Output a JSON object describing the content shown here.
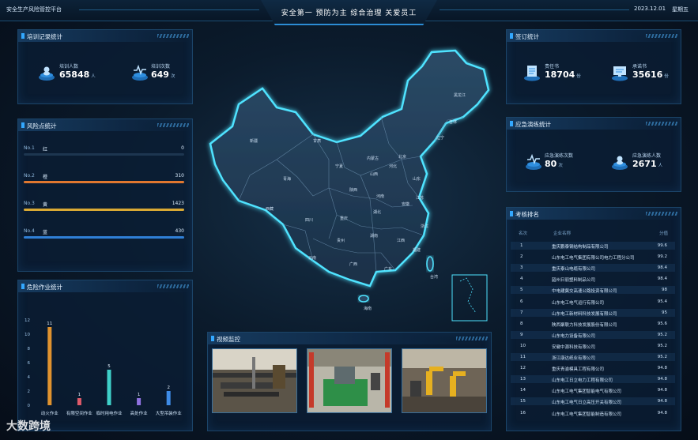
{
  "header": {
    "left_title": "安全生产风险管控平台",
    "center_title": "安全第一 预防为主 综合治理 关爱员工",
    "date": "2023.12.01",
    "weekday": "星期五"
  },
  "training": {
    "title": "培训记录统计",
    "stats": [
      {
        "label": "培训人数",
        "value": "65848",
        "unit": "人",
        "icon": "people-stack-icon"
      },
      {
        "label": "培训次数",
        "value": "649",
        "unit": "次",
        "icon": "pulse-stack-icon"
      }
    ]
  },
  "risk": {
    "title": "风险点统计",
    "levels": [
      {
        "no": "No.1",
        "name": "红",
        "value": "0",
        "fraction": 0.0,
        "color": "#e0433b"
      },
      {
        "no": "No.2",
        "name": "橙",
        "value": "310",
        "fraction": 1.0,
        "color": "#e0772f"
      },
      {
        "no": "No.3",
        "name": "黄",
        "value": "1423",
        "fraction": 1.0,
        "color": "#d9a934"
      },
      {
        "no": "No.4",
        "name": "蓝",
        "value": "430",
        "fraction": 1.0,
        "color": "#2f7fd6"
      }
    ]
  },
  "hazard": {
    "title": "危险作业统计",
    "chart_data": {
      "type": "bar",
      "categories": [
        "动火作业",
        "有限空间作业",
        "临时用电作业",
        "高处作业",
        "大型吊装作业"
      ],
      "values": [
        11,
        1,
        5,
        1,
        2
      ],
      "ylim": [
        0,
        12
      ],
      "yticks": [
        "0",
        "2",
        "4",
        "6",
        "8",
        "10",
        "12"
      ],
      "colors": [
        "#e0932f",
        "#e05a6a",
        "#3fd0c9",
        "#8f72e0",
        "#3e8be6"
      ],
      "grid": false,
      "legend": "none"
    }
  },
  "map": {
    "provinces": [
      "新疆",
      "西藏",
      "青海",
      "甘肃",
      "四川",
      "内蒙古",
      "黑龙江",
      "吉林",
      "辽宁",
      "河北",
      "北京",
      "山西",
      "陕西",
      "宁夏",
      "山东",
      "河南",
      "湖北",
      "湖南",
      "江西",
      "安徽",
      "江苏",
      "浙江",
      "福建",
      "广东",
      "广西",
      "贵州",
      "云南",
      "重庆",
      "海南",
      "台湾"
    ]
  },
  "video": {
    "title": "视频监控"
  },
  "contract": {
    "title": "签订统计",
    "stats": [
      {
        "label": "责任书",
        "value": "18704",
        "unit": "份",
        "icon": "document-icon"
      },
      {
        "label": "承诺书",
        "value": "35616",
        "unit": "份",
        "icon": "monitor-doc-icon"
      }
    ]
  },
  "emergency": {
    "title": "应急演练统计",
    "stats": [
      {
        "label": "应急演练次数",
        "value": "80",
        "unit": "次",
        "icon": "drill-count-icon"
      },
      {
        "label": "应急演练人数",
        "value": "2671",
        "unit": "人",
        "icon": "drill-people-icon"
      }
    ]
  },
  "ranking": {
    "title": "考核排名",
    "headers": {
      "rank": "名次",
      "name": "企业名称",
      "score": "分值"
    },
    "rows": [
      {
        "rank": "1",
        "name": "重庆鹏泰钢结构制品有限公司",
        "score": "99.6"
      },
      {
        "rank": "2",
        "name": "山东电工电气集团有限公司电力工程分公司",
        "score": "99.2"
      },
      {
        "rank": "3",
        "name": "重庆泰山电缆有限公司",
        "score": "98.4"
      },
      {
        "rank": "4",
        "name": "韶州日丽塑料制品公司",
        "score": "98.4"
      },
      {
        "rank": "5",
        "name": "中电建冀交高速公路投资有限公司",
        "score": "98"
      },
      {
        "rank": "6",
        "name": "山东电工电气运行有限公司",
        "score": "95.4"
      },
      {
        "rank": "7",
        "name": "山东电工新材料科技发展有限公司",
        "score": "95"
      },
      {
        "rank": "8",
        "name": "陕西聚联力科技发展股份有限公司",
        "score": "95.6"
      },
      {
        "rank": "9",
        "name": "山东电力设备有限公司",
        "score": "95.2"
      },
      {
        "rank": "10",
        "name": "安徽中源科技有限公司",
        "score": "95.2"
      },
      {
        "rank": "11",
        "name": "浙江康达纸业有限公司",
        "score": "95.2"
      },
      {
        "rank": "12",
        "name": "重庆青渝模具工程有限公司",
        "score": "94.8"
      },
      {
        "rank": "13",
        "name": "山东电工日立电力工程有限公司",
        "score": "94.8"
      },
      {
        "rank": "14",
        "name": "山东电工电气集团智能电气有限公司",
        "score": "94.8"
      },
      {
        "rank": "15",
        "name": "山东电工电气日立高压开关有限公司",
        "score": "94.8"
      },
      {
        "rank": "16",
        "name": "山东电工电气集团智能制造有限公司",
        "score": "94.8"
      }
    ]
  },
  "watermark": "大数跨境"
}
